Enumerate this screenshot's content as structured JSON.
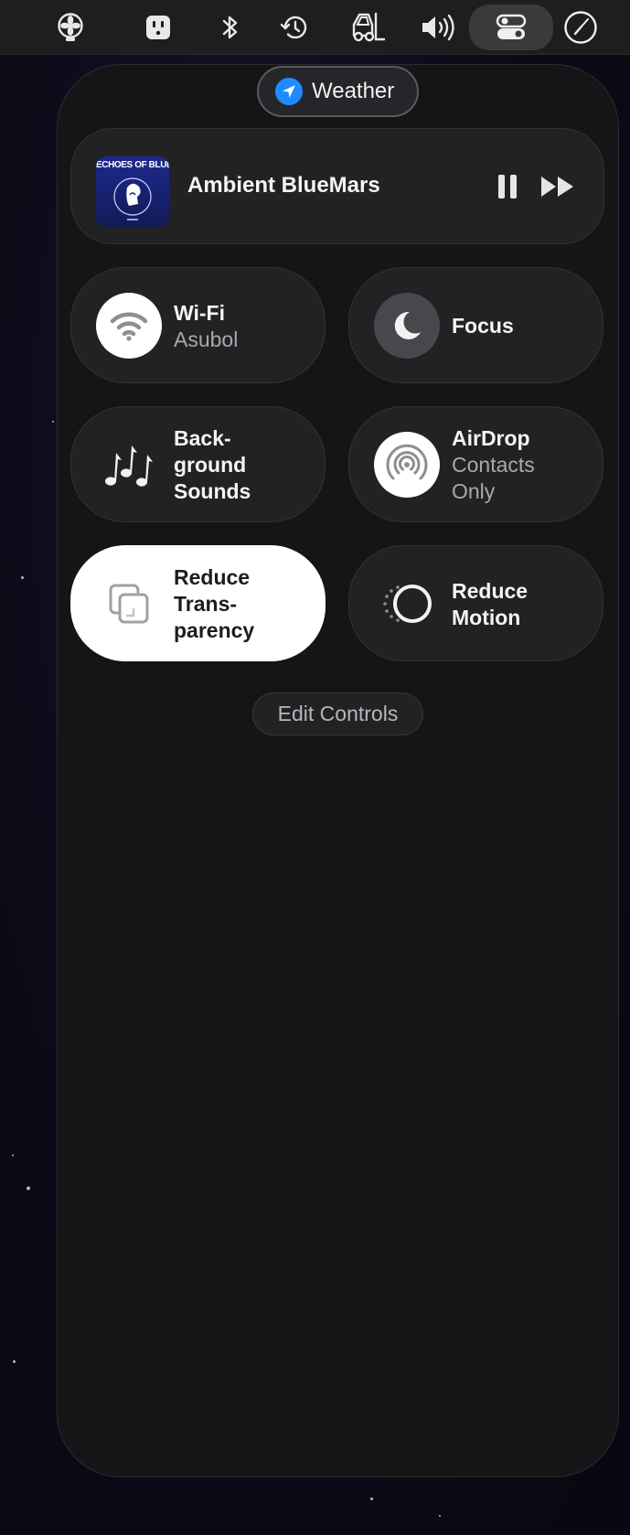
{
  "menubar": {
    "icons": [
      {
        "name": "fan-icon"
      },
      {
        "name": "power-outlet-icon"
      },
      {
        "name": "bluetooth-icon"
      },
      {
        "name": "time-machine-icon"
      },
      {
        "name": "forklift-icon"
      },
      {
        "name": "volume-icon"
      },
      {
        "name": "control-center-icon",
        "active": true
      },
      {
        "name": "clock-icon"
      }
    ]
  },
  "weather": {
    "label": "Weather",
    "accent": "#1e8cff"
  },
  "now_playing": {
    "album_text": "ECHOES OF BLUEMARS",
    "track": "Ambient BlueMars",
    "controls": [
      "pause",
      "next"
    ]
  },
  "controls": {
    "wifi": {
      "title": "Wi-Fi",
      "subtitle": "Asubol"
    },
    "focus": {
      "title": "Focus"
    },
    "background_sounds": {
      "line1": "Back-",
      "line2": "ground",
      "line3": "Sounds"
    },
    "airdrop": {
      "title": "AirDrop",
      "line1": "Contacts",
      "line2": "Only"
    },
    "reduce_transparency": {
      "line1": "Reduce",
      "line2": "Trans-",
      "line3": "parency",
      "active": true
    },
    "reduce_motion": {
      "line1": "Reduce",
      "line2": "Motion"
    }
  },
  "edit_controls": {
    "label": "Edit Controls"
  }
}
